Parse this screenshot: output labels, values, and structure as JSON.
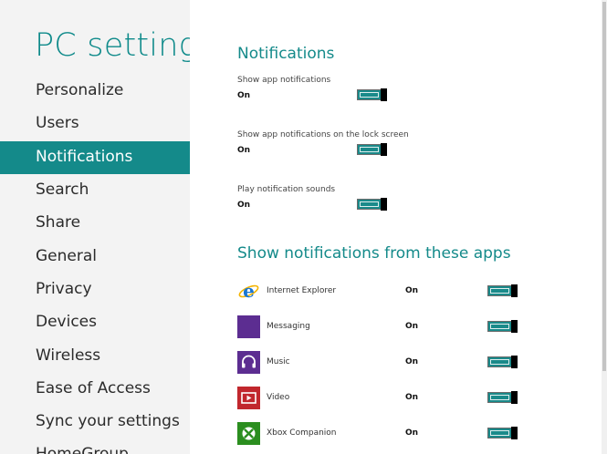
{
  "app": {
    "title": "PC settings",
    "accent_color": "#148a8a",
    "sidebar_background": "#f3f3f3"
  },
  "sidebar": {
    "items": [
      {
        "label": "Personalize",
        "selected": false
      },
      {
        "label": "Users",
        "selected": false
      },
      {
        "label": "Notifications",
        "selected": true
      },
      {
        "label": "Search",
        "selected": false
      },
      {
        "label": "Share",
        "selected": false
      },
      {
        "label": "General",
        "selected": false
      },
      {
        "label": "Privacy",
        "selected": false
      },
      {
        "label": "Devices",
        "selected": false
      },
      {
        "label": "Wireless",
        "selected": false
      },
      {
        "label": "Ease of Access",
        "selected": false
      },
      {
        "label": "Sync your settings",
        "selected": false
      },
      {
        "label": "HomeGroup",
        "selected": false
      }
    ]
  },
  "notifications": {
    "heading": "Notifications",
    "settings": [
      {
        "label": "Show app notifications",
        "state": "On",
        "on": true
      },
      {
        "label": "Show app notifications on the lock screen",
        "state": "On",
        "on": true
      },
      {
        "label": "Play notification sounds",
        "state": "On",
        "on": true
      }
    ]
  },
  "apps": {
    "heading": "Show notifications from these apps",
    "items": [
      {
        "name": "Internet Explorer",
        "state": "On",
        "on": true,
        "icon": "internet-explorer-icon",
        "icon_color": "#ffffff"
      },
      {
        "name": "Messaging",
        "state": "On",
        "on": true,
        "icon": "messaging-icon",
        "icon_color": "#5c2d91"
      },
      {
        "name": "Music",
        "state": "On",
        "on": true,
        "icon": "music-icon",
        "icon_color": "#5c2d91"
      },
      {
        "name": "Video",
        "state": "On",
        "on": true,
        "icon": "video-icon",
        "icon_color": "#c1272d"
      },
      {
        "name": "Xbox Companion",
        "state": "On",
        "on": true,
        "icon": "xbox-icon",
        "icon_color": "#2b8e1f"
      }
    ]
  }
}
